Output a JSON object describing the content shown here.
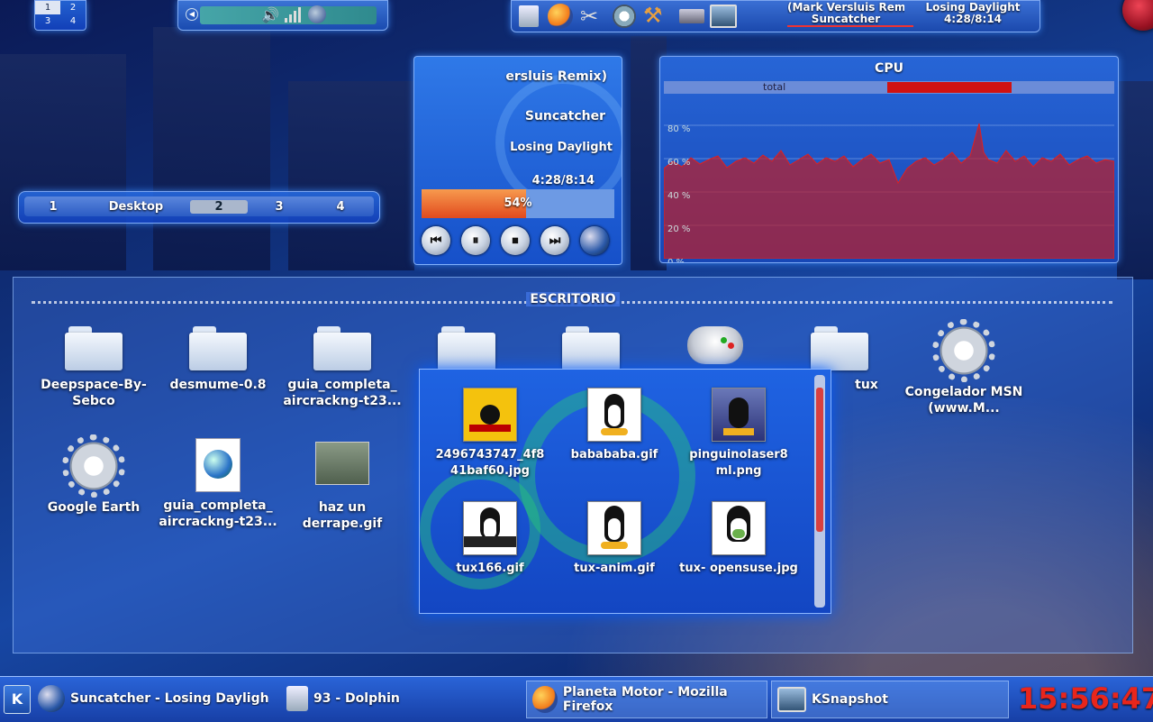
{
  "pager_mini": {
    "desks": [
      "1",
      "2",
      "3",
      "4"
    ]
  },
  "now_playing_top": {
    "artist_line": "(Mark Versluis Remix)",
    "artist": "Suncatcher",
    "title": "Losing Daylight",
    "time": "4:28/8:14"
  },
  "player": {
    "scroll_text": "ersluis Remix)",
    "artist": "Suncatcher",
    "title": "Losing Daylight",
    "time": "4:28/8:14",
    "progress_label": "54%",
    "progress": 0.54,
    "controls": [
      "previous-icon",
      "pause-icon",
      "stop-icon",
      "next-icon",
      "amarok-icon"
    ]
  },
  "cpu": {
    "title": "CPU",
    "legend": "total",
    "y_ticks": [
      "80 %",
      "60 %",
      "40 %",
      "20 %",
      "0 %"
    ]
  },
  "pager": {
    "items": [
      "1",
      "Desktop",
      "2",
      "3",
      "4"
    ],
    "active": "2"
  },
  "folderview": {
    "title": "ESCRITORIO",
    "items": [
      {
        "label": "Deepspace-By-Sebco",
        "icon": "folder-icon"
      },
      {
        "label": "desmume-0.8",
        "icon": "folder-icon"
      },
      {
        "label": "guia_completa_ aircrackng-t23...",
        "icon": "folder-icon"
      },
      {
        "label": "",
        "icon": "folder-icon"
      },
      {
        "label": "",
        "icon": "folder-icon"
      },
      {
        "label": "",
        "icon": "gamepad-icon"
      },
      {
        "label": "tux",
        "icon": "folder-icon"
      },
      {
        "label": "Congelador MSN (www.M...",
        "icon": "gear-icon"
      },
      {
        "label": "Google Earth",
        "icon": "gear-icon"
      },
      {
        "label": "guia_completa_ aircrackng-t23...",
        "icon": "web-document-icon"
      },
      {
        "label": "haz un derrape.gif",
        "icon": "image-icon"
      }
    ]
  },
  "popup": {
    "items": [
      {
        "label": "2496743747_4f8 41baf60.jpg",
        "icon": "kill-bill-image-icon"
      },
      {
        "label": "babababa.gif",
        "icon": "tux-image-icon"
      },
      {
        "label": "pinguinolaser8 ml.png",
        "icon": "tux-laser-image-icon"
      },
      {
        "label": "tux166.gif",
        "icon": "tux-image-icon"
      },
      {
        "label": "tux-anim.gif",
        "icon": "tux-image-icon"
      },
      {
        "label": "tux- opensuse.jpg",
        "icon": "tux-image-icon"
      }
    ]
  },
  "taskbar": {
    "tasks": [
      {
        "label": "Suncatcher - Losing Daylight (",
        "icon": "amarok-icon"
      },
      {
        "label": "93 - Dolphin",
        "icon": "dolphin-icon"
      },
      {
        "label": "Planeta Motor - Mozilla Firefox",
        "icon": "firefox-icon"
      },
      {
        "label": "KSnapshot",
        "icon": "ksnapshot-icon"
      }
    ],
    "clock": "15:56:47"
  },
  "colors": {
    "accent": "#1e5ee0",
    "clock": "#e8261c",
    "cpu_fill": "#b0242a",
    "progress": "#e9512a"
  }
}
